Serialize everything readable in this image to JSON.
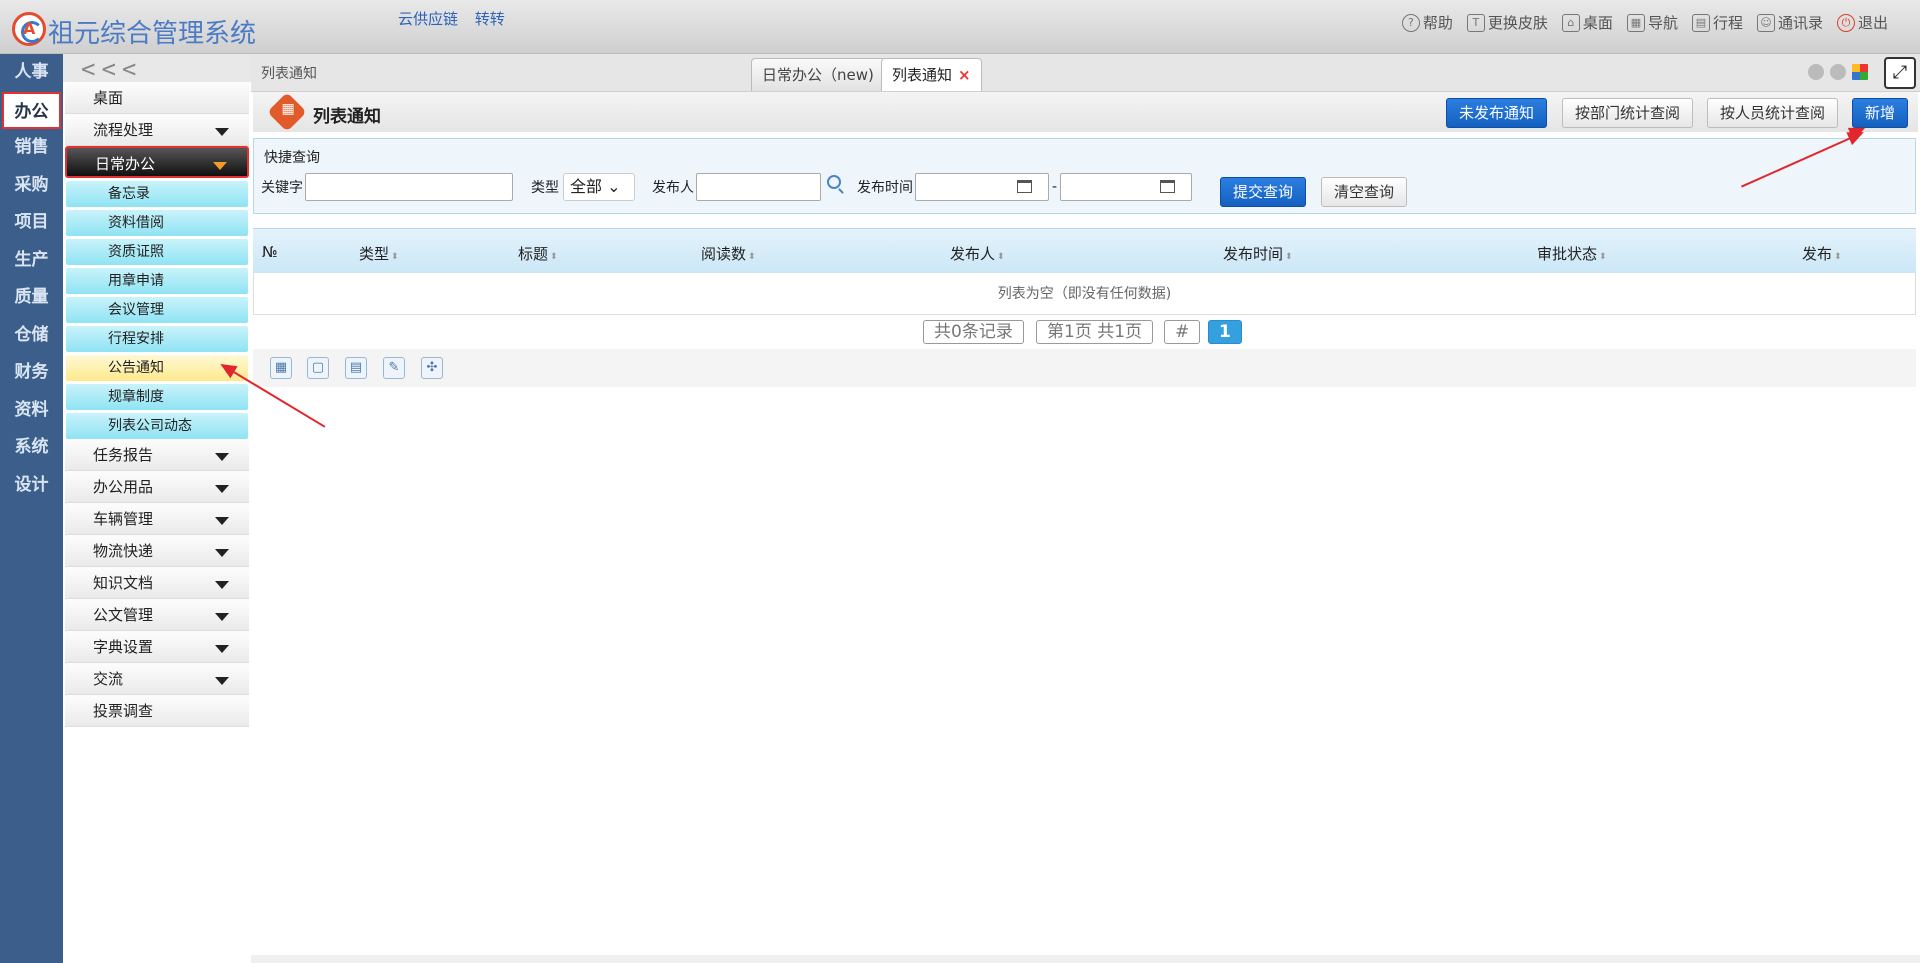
{
  "app": {
    "title": "祖元综合管理系统",
    "links": [
      "云供应链",
      "转转"
    ]
  },
  "top_actions": [
    {
      "label": "帮助",
      "icon": "help-icon",
      "glyph": "?"
    },
    {
      "label": "更换皮肤",
      "icon": "shirt-icon",
      "glyph": "T"
    },
    {
      "label": "桌面",
      "icon": "home-icon",
      "glyph": "⌂"
    },
    {
      "label": "导航",
      "icon": "grid-icon",
      "glyph": "▦"
    },
    {
      "label": "行程",
      "icon": "calendar-icon",
      "glyph": "▤"
    },
    {
      "label": "通讯录",
      "icon": "contacts-icon",
      "glyph": "☺"
    },
    {
      "label": "退出",
      "icon": "power-icon",
      "glyph": "⏻"
    }
  ],
  "rail": [
    "人事",
    "办公",
    "销售",
    "采购",
    "项目",
    "生产",
    "质量",
    "仓储",
    "财务",
    "资料",
    "系统",
    "设计"
  ],
  "rail_active": "办公",
  "sidebar": {
    "collapse": "<<<",
    "top": [
      "桌面",
      "流程处理"
    ],
    "open_group": "日常办公",
    "sub_items": [
      "备忘录",
      "资料借阅",
      "资质证照",
      "用章申请",
      "会议管理",
      "行程安排",
      "公告通知",
      "规章制度",
      "列表公司动态"
    ],
    "selected_sub": "公告通知",
    "groups": [
      "任务报告",
      "办公用品",
      "车辆管理",
      "物流快递",
      "知识文档",
      "公文管理",
      "字典设置",
      "交流"
    ],
    "last": "投票调查"
  },
  "tabbar": {
    "crumb": "列表通知",
    "tabs": [
      "日常办公（new)",
      "列表通知"
    ],
    "close": "×",
    "fullscreen": "⤢"
  },
  "page": {
    "title": "列表通知",
    "buttons": {
      "unpublished": "未发布通知",
      "by_dept": "按部门统计查阅",
      "by_person": "按人员统计查阅",
      "add": "新增"
    }
  },
  "quick": {
    "title": "快捷查询",
    "keyword_label": "关键字",
    "keyword_value": "",
    "type_label": "类型",
    "type_value": "全部",
    "publisher_label": "发布人",
    "publisher_value": "",
    "time_label": "发布时间",
    "dash": "-",
    "submit": "提交查询",
    "clear": "清空查询"
  },
  "table": {
    "columns": [
      "№",
      "类型",
      "标题",
      "阅读数",
      "发布人",
      "发布时间",
      "审批状态",
      "发布"
    ],
    "sort_glyph": "⬍",
    "empty": "列表为空（即没有任何数据)"
  },
  "pager": {
    "records": "共0条记录",
    "pages": "第1页 共1页",
    "hash": "#",
    "current": "1"
  },
  "tool_icons": [
    "▦",
    "▢",
    "▤",
    "✎",
    "✣"
  ],
  "colors": {
    "rail": "#3b5f8a",
    "primary": "#1460c0",
    "highlight": "#e3262d"
  }
}
